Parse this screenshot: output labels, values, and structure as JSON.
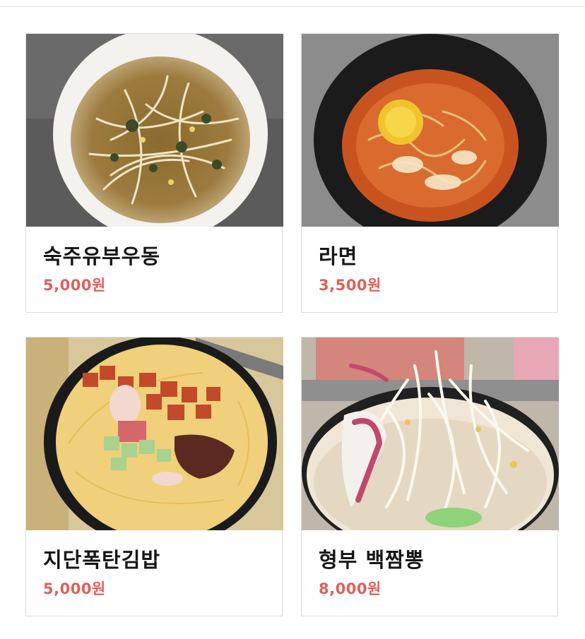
{
  "menu": {
    "items": [
      {
        "name": "숙주유부우동",
        "price": "5,000원",
        "image": "bean-sprout-udon-photo"
      },
      {
        "name": "라면",
        "price": "3,500원",
        "image": "ramyeon-photo"
      },
      {
        "name": "지단폭탄김밥",
        "price": "5,000원",
        "image": "egg-kimbap-photo"
      },
      {
        "name": "형부 백짬뽕",
        "price": "8,000원",
        "image": "white-jjamppong-photo"
      }
    ]
  },
  "colors": {
    "price": "#e0605a",
    "title": "#161616",
    "border": "#dcdcdc"
  }
}
